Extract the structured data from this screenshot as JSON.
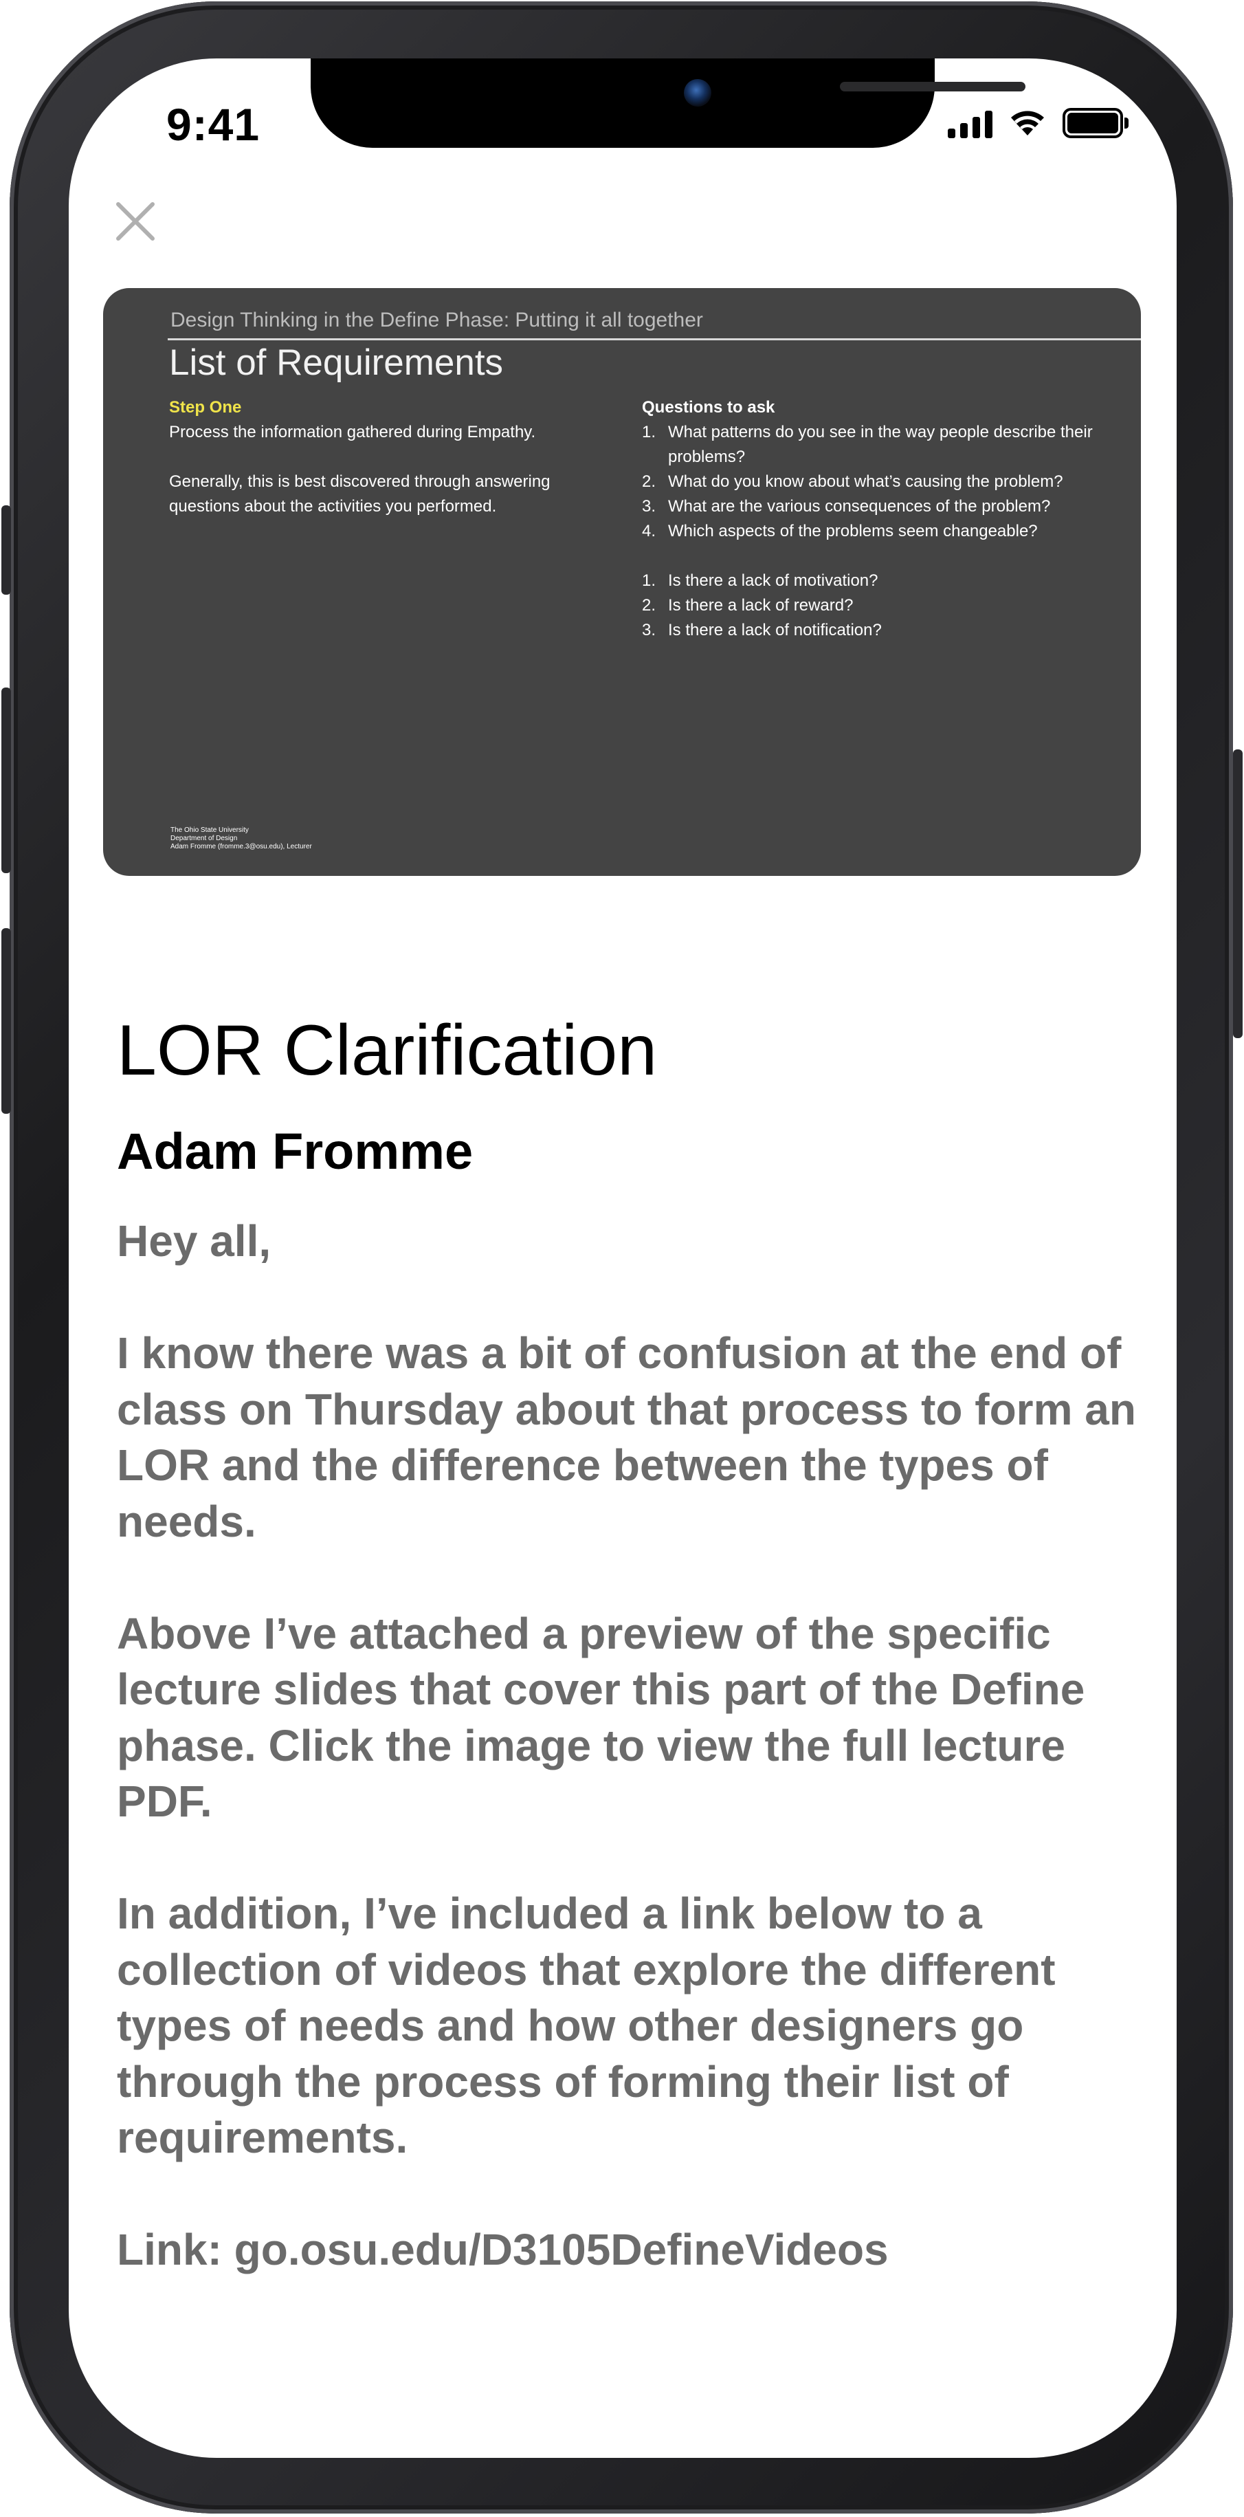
{
  "status_bar": {
    "time": "9:41"
  },
  "slide": {
    "header": "Design Thinking in the Define Phase: Putting it all together",
    "title": "List of Requirements",
    "step_label": "Step One",
    "left_para_1": "Process the information gathered during Empathy.",
    "left_para_2": "Generally, this is best discovered through answering questions about the activities you performed.",
    "questions_heading": "Questions to ask",
    "questions": [
      {
        "num": "1.",
        "text": "What patterns do you see in the way people describe their problems?"
      },
      {
        "num": "2.",
        "text": "What do you know about what’s causing the problem?"
      },
      {
        "num": "3.",
        "text": "What are the various consequences of the problem?"
      },
      {
        "num": "4.",
        "text": "Which aspects of the problems seem changeable?"
      }
    ],
    "questions_2": [
      {
        "num": "1.",
        "text": "Is there a lack of motivation?"
      },
      {
        "num": "2.",
        "text": "Is there a lack of reward?"
      },
      {
        "num": "3.",
        "text": "Is there a lack of notification?"
      }
    ],
    "footer_lines": [
      "The Ohio State University",
      "Department of Design",
      "Adam Fromme (fromme.3@osu.edu), Lecturer"
    ]
  },
  "post": {
    "title": "LOR Clarification",
    "author": "Adam Fromme",
    "greeting": "Hey all,",
    "para_1": "I know there was a bit of confusion at the end of class on Thursday about that process to form an LOR and the difference between the types of needs.",
    "para_2": "Above I’ve attached a preview of the specific lecture slides that cover this part of the Define phase. Click the image to view the full lecture PDF.",
    "para_3": "In addition, I’ve included a link below to a collection of videos that explore the different types of needs and how other designers go through the process of forming their list of requirements.",
    "link_label": "Link: ",
    "link_url": "go.osu.edu/D3105DefineVideos"
  },
  "colors": {
    "slide_background": "#444444",
    "slide_step_accent": "#f0e44a",
    "body_text": "#6b6b6b",
    "close_icon": "#b0b0b0"
  },
  "icons": {
    "close": "close-icon",
    "signal": "cellular-signal-icon",
    "wifi": "wifi-icon",
    "battery": "battery-icon"
  }
}
